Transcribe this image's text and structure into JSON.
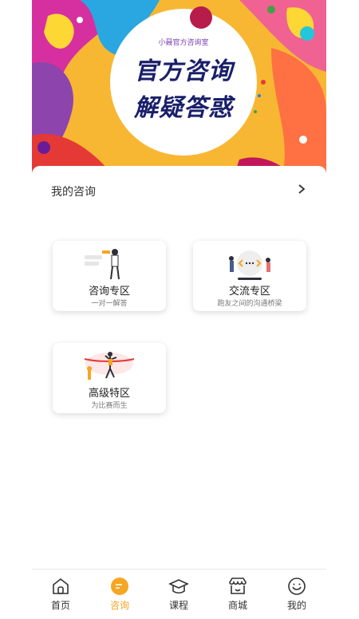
{
  "banner": {
    "subtitle": "小聂官方咨询室",
    "line1": "官方咨询",
    "line2": "解疑答惑"
  },
  "section": {
    "title": "我的咨询"
  },
  "tiles": [
    {
      "title": "咨询专区",
      "subtitle": "一对一解答"
    },
    {
      "title": "交流专区",
      "subtitle": "跑友之间的沟通桥梁"
    },
    {
      "title": "高级特区",
      "subtitle": "为比赛而生"
    }
  ],
  "nav": {
    "items": [
      {
        "label": "首页",
        "icon": "home-icon"
      },
      {
        "label": "咨询",
        "icon": "chat-bubble-icon",
        "active": true
      },
      {
        "label": "课程",
        "icon": "graduation-cap-icon"
      },
      {
        "label": "商城",
        "icon": "store-icon"
      },
      {
        "label": "我的",
        "icon": "smile-face-icon"
      }
    ]
  },
  "colors": {
    "accent": "#f5a623",
    "title_blue": "#1a1f6b"
  }
}
